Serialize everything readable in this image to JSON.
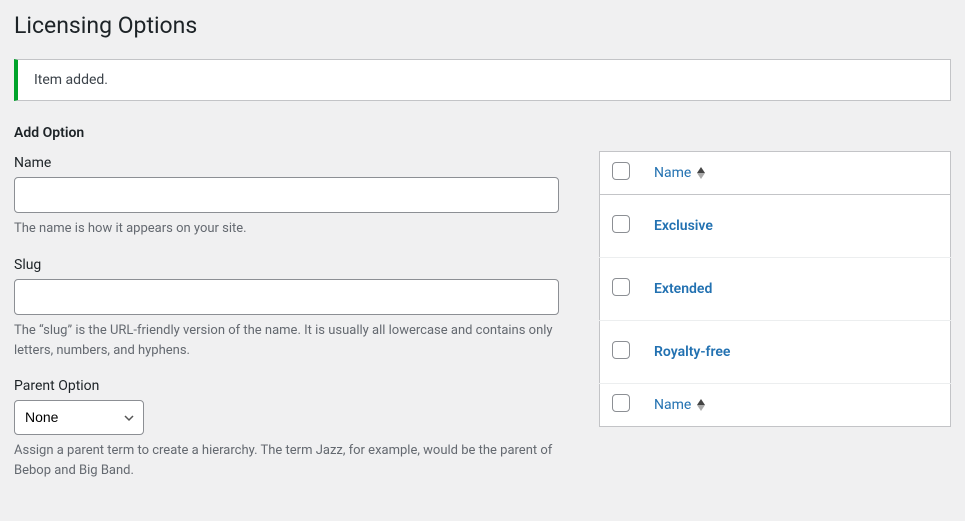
{
  "page_title": "Licensing Options",
  "notice": {
    "message": "Item added."
  },
  "form": {
    "heading": "Add Option",
    "name": {
      "label": "Name",
      "value": "",
      "desc": "The name is how it appears on your site."
    },
    "slug": {
      "label": "Slug",
      "value": "",
      "desc": "The “slug” is the URL-friendly version of the name. It is usually all lowercase and contains only letters, numbers, and hyphens."
    },
    "parent": {
      "label": "Parent Option",
      "selected": "None",
      "desc": "Assign a parent term to create a hierarchy. The term Jazz, for example, would be the parent of Bebop and Big Band."
    }
  },
  "table": {
    "col_name": "Name",
    "rows": [
      {
        "title": "Exclusive"
      },
      {
        "title": "Extended"
      },
      {
        "title": "Royalty-free"
      }
    ]
  }
}
